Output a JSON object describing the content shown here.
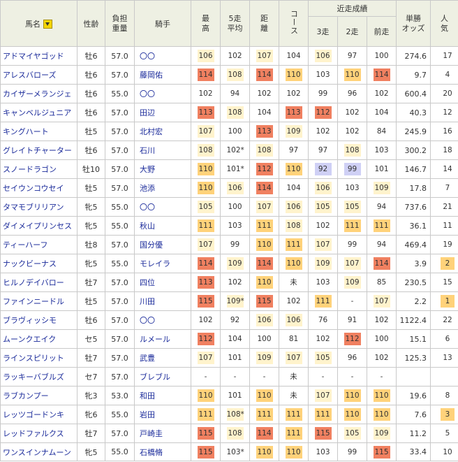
{
  "header": {
    "horse_name": "馬名",
    "sex_age": "性齢",
    "weight_l1": "負担",
    "weight_l2": "重量",
    "jockey": "騎手",
    "best_l1": "最",
    "best_l2": "高",
    "avg5_l1": "5走",
    "avg5_l2": "平均",
    "distance_l1": "距",
    "distance_l2": "離",
    "course": "コース",
    "recent": "近走成績",
    "run3": "3走",
    "run2": "2走",
    "prev": "前走",
    "odds_l1": "単勝",
    "odds_l2": "オッズ",
    "pop_l1": "人",
    "pop_l2": "気"
  },
  "colors": {
    "c1": "#fff3cc",
    "c2": "#ffd27a",
    "c3": "#ffba4f",
    "c4": "#f08060",
    "c5": "#cfd0f5"
  },
  "rows": [
    {
      "name": "アドマイヤゴッド",
      "sex": "牡6",
      "wt": "57.0",
      "jockey": "〇〇",
      "best": "106",
      "best_c": "c1",
      "avg": "102",
      "avg_c": "c0",
      "dist": "107",
      "dist_c": "c1",
      "course": "104",
      "course_c": "c0",
      "r3": "106",
      "r3_c": "c1",
      "r2": "97",
      "r2_c": "c0",
      "r1": "100",
      "r1_c": "c0",
      "odds": "274.6",
      "pop": "17",
      "pop_c": "c0"
    },
    {
      "name": "アレスバローズ",
      "sex": "牡6",
      "wt": "57.0",
      "jockey": "藤岡佑",
      "best": "114",
      "best_c": "c4",
      "avg": "108",
      "avg_c": "c1",
      "dist": "114",
      "dist_c": "c4",
      "course": "110",
      "course_c": "c2",
      "r3": "103",
      "r3_c": "c0",
      "r2": "110",
      "r2_c": "c2",
      "r1": "114",
      "r1_c": "c4",
      "odds": "9.7",
      "pop": "4",
      "pop_c": "c0"
    },
    {
      "name": "カイザーメランジェ",
      "sex": "牡6",
      "wt": "55.0",
      "jockey": "〇〇",
      "best": "102",
      "best_c": "c0",
      "avg": "94",
      "avg_c": "c0",
      "dist": "102",
      "dist_c": "c0",
      "course": "102",
      "course_c": "c0",
      "r3": "99",
      "r3_c": "c0",
      "r2": "96",
      "r2_c": "c0",
      "r1": "102",
      "r1_c": "c0",
      "odds": "600.4",
      "pop": "20",
      "pop_c": "c0"
    },
    {
      "name": "キャンベルジュニア",
      "sex": "牡6",
      "wt": "57.0",
      "jockey": "田辺",
      "best": "113",
      "best_c": "c4",
      "avg": "108",
      "avg_c": "c1",
      "dist": "104",
      "dist_c": "c0",
      "course": "113",
      "course_c": "c4",
      "r3": "112",
      "r3_c": "c4",
      "r2": "102",
      "r2_c": "c0",
      "r1": "104",
      "r1_c": "c0",
      "odds": "40.3",
      "pop": "12",
      "pop_c": "c0"
    },
    {
      "name": "キングハート",
      "sex": "牡5",
      "wt": "57.0",
      "jockey": "北村宏",
      "best": "107",
      "best_c": "c1",
      "avg": "100",
      "avg_c": "c0",
      "dist": "113",
      "dist_c": "c4",
      "course": "109",
      "course_c": "c1",
      "r3": "102",
      "r3_c": "c0",
      "r2": "102",
      "r2_c": "c0",
      "r1": "84",
      "r1_c": "c0",
      "odds": "245.9",
      "pop": "16",
      "pop_c": "c0"
    },
    {
      "name": "グレイトチャーター",
      "sex": "牡6",
      "wt": "57.0",
      "jockey": "石川",
      "best": "108",
      "best_c": "c1",
      "avg": "102*",
      "avg_c": "c0",
      "dist": "108",
      "dist_c": "c1",
      "course": "97",
      "course_c": "c0",
      "r3": "97",
      "r3_c": "c0",
      "r2": "108",
      "r2_c": "c1",
      "r1": "103",
      "r1_c": "c0",
      "odds": "300.2",
      "pop": "18",
      "pop_c": "c0"
    },
    {
      "name": "スノードラゴン",
      "sex": "牡10",
      "wt": "57.0",
      "jockey": "大野",
      "best": "110",
      "best_c": "c2",
      "avg": "101*",
      "avg_c": "c0",
      "dist": "112",
      "dist_c": "c4",
      "course": "110",
      "course_c": "c2",
      "r3": "92",
      "r3_c": "c5",
      "r2": "99",
      "r2_c": "c5",
      "r1": "101",
      "r1_c": "c0",
      "odds": "146.7",
      "pop": "14",
      "pop_c": "c0"
    },
    {
      "name": "セイウンコウセイ",
      "sex": "牡5",
      "wt": "57.0",
      "jockey": "池添",
      "best": "110",
      "best_c": "c2",
      "avg": "106",
      "avg_c": "c1",
      "dist": "114",
      "dist_c": "c4",
      "course": "104",
      "course_c": "c0",
      "r3": "106",
      "r3_c": "c1",
      "r2": "103",
      "r2_c": "c0",
      "r1": "109",
      "r1_c": "c1",
      "odds": "17.8",
      "pop": "7",
      "pop_c": "c0"
    },
    {
      "name": "タマモブリリアン",
      "sex": "牝5",
      "wt": "55.0",
      "jockey": "〇〇",
      "best": "105",
      "best_c": "c1",
      "avg": "100",
      "avg_c": "c0",
      "dist": "107",
      "dist_c": "c1",
      "course": "106",
      "course_c": "c1",
      "r3": "105",
      "r3_c": "c1",
      "r2": "105",
      "r2_c": "c1",
      "r1": "94",
      "r1_c": "c0",
      "odds": "737.6",
      "pop": "21",
      "pop_c": "c0"
    },
    {
      "name": "ダイメイプリンセス",
      "sex": "牝5",
      "wt": "55.0",
      "jockey": "秋山",
      "best": "111",
      "best_c": "c2",
      "avg": "103",
      "avg_c": "c0",
      "dist": "111",
      "dist_c": "c2",
      "course": "108",
      "course_c": "c1",
      "r3": "102",
      "r3_c": "c0",
      "r2": "111",
      "r2_c": "c2",
      "r1": "111",
      "r1_c": "c2",
      "odds": "36.1",
      "pop": "11",
      "pop_c": "c0"
    },
    {
      "name": "ティーハーフ",
      "sex": "牡8",
      "wt": "57.0",
      "jockey": "国分優",
      "best": "107",
      "best_c": "c1",
      "avg": "99",
      "avg_c": "c0",
      "dist": "110",
      "dist_c": "c2",
      "course": "111",
      "course_c": "c2",
      "r3": "107",
      "r3_c": "c1",
      "r2": "99",
      "r2_c": "c0",
      "r1": "94",
      "r1_c": "c0",
      "odds": "469.4",
      "pop": "19",
      "pop_c": "c0"
    },
    {
      "name": "ナックビーナス",
      "sex": "牝5",
      "wt": "55.0",
      "jockey": "モレイラ",
      "best": "114",
      "best_c": "c4",
      "avg": "109",
      "avg_c": "c1",
      "dist": "114",
      "dist_c": "c4",
      "course": "110",
      "course_c": "c2",
      "r3": "109",
      "r3_c": "c1",
      "r2": "107",
      "r2_c": "c1",
      "r1": "114",
      "r1_c": "c4",
      "odds": "3.9",
      "pop": "2",
      "pop_c": "c2"
    },
    {
      "name": "ヒルノデイバロー",
      "sex": "牡7",
      "wt": "57.0",
      "jockey": "四位",
      "best": "113",
      "best_c": "c4",
      "avg": "102",
      "avg_c": "c0",
      "dist": "110",
      "dist_c": "c2",
      "course": "未",
      "course_c": "c0",
      "r3": "103",
      "r3_c": "c0",
      "r2": "109",
      "r2_c": "c1",
      "r1": "85",
      "r1_c": "c0",
      "odds": "230.5",
      "pop": "15",
      "pop_c": "c0"
    },
    {
      "name": "ファインニードル",
      "sex": "牡5",
      "wt": "57.0",
      "jockey": "川田",
      "best": "115",
      "best_c": "c4",
      "avg": "109*",
      "avg_c": "c1",
      "dist": "115",
      "dist_c": "c4",
      "course": "102",
      "course_c": "c0",
      "r3": "111",
      "r3_c": "c2",
      "r2": "-",
      "r2_c": "c0",
      "r1": "107",
      "r1_c": "c1",
      "odds": "2.2",
      "pop": "1",
      "pop_c": "c2"
    },
    {
      "name": "ブラヴィッシモ",
      "sex": "牡6",
      "wt": "57.0",
      "jockey": "〇〇",
      "best": "102",
      "best_c": "c0",
      "avg": "92",
      "avg_c": "c0",
      "dist": "106",
      "dist_c": "c1",
      "course": "106",
      "course_c": "c1",
      "r3": "76",
      "r3_c": "c0",
      "r2": "91",
      "r2_c": "c0",
      "r1": "102",
      "r1_c": "c0",
      "odds": "1122.4",
      "pop": "22",
      "pop_c": "c0"
    },
    {
      "name": "ムーンクエイク",
      "sex": "セ5",
      "wt": "57.0",
      "jockey": "ルメール",
      "best": "112",
      "best_c": "c4",
      "avg": "104",
      "avg_c": "c0",
      "dist": "100",
      "dist_c": "c0",
      "course": "81",
      "course_c": "c0",
      "r3": "102",
      "r3_c": "c0",
      "r2": "112",
      "r2_c": "c4",
      "r1": "100",
      "r1_c": "c0",
      "odds": "15.1",
      "pop": "6",
      "pop_c": "c0"
    },
    {
      "name": "ラインスピリット",
      "sex": "牡7",
      "wt": "57.0",
      "jockey": "武豊",
      "best": "107",
      "best_c": "c1",
      "avg": "101",
      "avg_c": "c0",
      "dist": "109",
      "dist_c": "c1",
      "course": "107",
      "course_c": "c1",
      "r3": "105",
      "r3_c": "c1",
      "r2": "96",
      "r2_c": "c0",
      "r1": "102",
      "r1_c": "c0",
      "odds": "125.3",
      "pop": "13",
      "pop_c": "c0"
    },
    {
      "name": "ラッキーバブルズ",
      "sex": "セ7",
      "wt": "57.0",
      "jockey": "ブレブル",
      "best": "-",
      "best_c": "c0",
      "avg": "-",
      "avg_c": "c0",
      "dist": "-",
      "dist_c": "c0",
      "course": "未",
      "course_c": "c0",
      "r3": "-",
      "r3_c": "c0",
      "r2": "-",
      "r2_c": "c0",
      "r1": "-",
      "r1_c": "c0",
      "odds": "",
      "pop": "",
      "pop_c": "c0"
    },
    {
      "name": "ラブカンプー",
      "sex": "牝3",
      "wt": "53.0",
      "jockey": "和田",
      "best": "110",
      "best_c": "c2",
      "avg": "101",
      "avg_c": "c0",
      "dist": "110",
      "dist_c": "c2",
      "course": "未",
      "course_c": "c0",
      "r3": "107",
      "r3_c": "c1",
      "r2": "110",
      "r2_c": "c2",
      "r1": "110",
      "r1_c": "c2",
      "odds": "19.6",
      "pop": "8",
      "pop_c": "c0"
    },
    {
      "name": "レッツゴードンキ",
      "sex": "牝6",
      "wt": "55.0",
      "jockey": "岩田",
      "best": "111",
      "best_c": "c2",
      "avg": "108*",
      "avg_c": "c1",
      "dist": "111",
      "dist_c": "c2",
      "course": "111",
      "course_c": "c2",
      "r3": "111",
      "r3_c": "c2",
      "r2": "110",
      "r2_c": "c2",
      "r1": "110",
      "r1_c": "c2",
      "odds": "7.6",
      "pop": "3",
      "pop_c": "c2"
    },
    {
      "name": "レッドファルクス",
      "sex": "牡7",
      "wt": "57.0",
      "jockey": "戸崎圭",
      "best": "115",
      "best_c": "c4",
      "avg": "108",
      "avg_c": "c1",
      "dist": "114",
      "dist_c": "c4",
      "course": "111",
      "course_c": "c2",
      "r3": "115",
      "r3_c": "c4",
      "r2": "105",
      "r2_c": "c1",
      "r1": "109",
      "r1_c": "c1",
      "odds": "11.2",
      "pop": "5",
      "pop_c": "c0"
    },
    {
      "name": "ワンスインナムーン",
      "sex": "牝5",
      "wt": "55.0",
      "jockey": "石橋脩",
      "best": "115",
      "best_c": "c4",
      "avg": "103*",
      "avg_c": "c0",
      "dist": "110",
      "dist_c": "c2",
      "course": "110",
      "course_c": "c2",
      "r3": "103",
      "r3_c": "c0",
      "r2": "99",
      "r2_c": "c0",
      "r1": "115",
      "r1_c": "c4",
      "odds": "33.4",
      "pop": "10",
      "pop_c": "c0"
    }
  ]
}
